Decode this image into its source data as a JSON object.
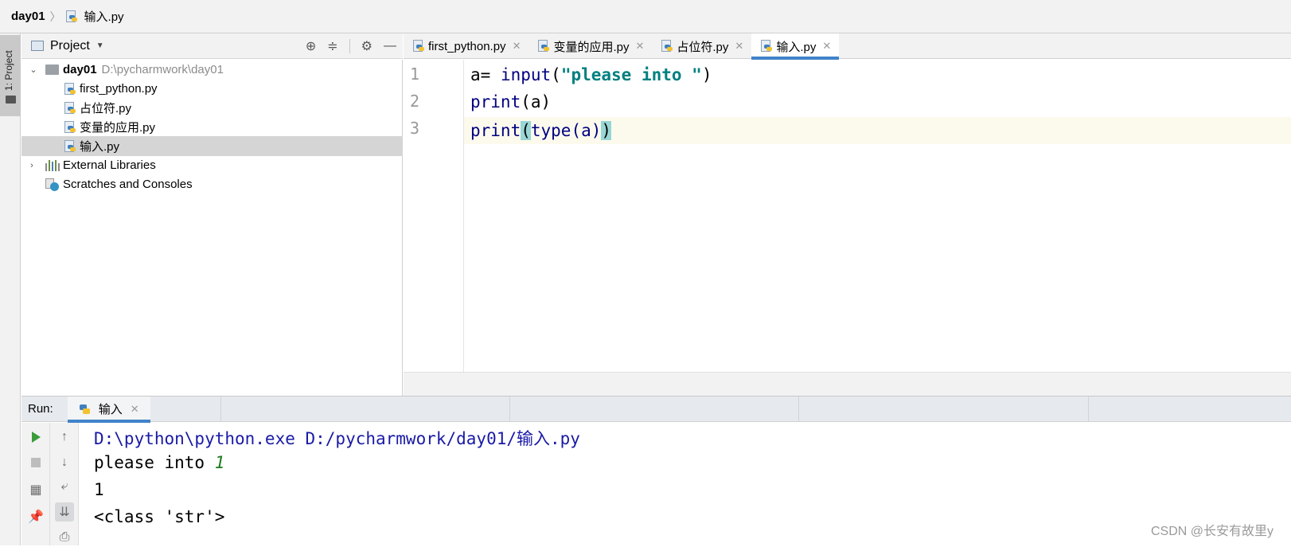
{
  "breadcrumb": {
    "root": "day01",
    "file": "输入.py"
  },
  "tool_stripe": {
    "label": "1: Project"
  },
  "project_panel": {
    "title": "Project",
    "tree": {
      "root_name": "day01",
      "root_path": "D:\\pycharmwork\\day01",
      "files": [
        "first_python.py",
        "占位符.py",
        "变量的应用.py",
        "输入.py"
      ],
      "selected_file": "输入.py",
      "external_libraries": "External Libraries",
      "scratches": "Scratches and Consoles"
    }
  },
  "editor": {
    "tabs": [
      {
        "label": "first_python.py"
      },
      {
        "label": "变量的应用.py"
      },
      {
        "label": "占位符.py"
      },
      {
        "label": "输入.py"
      }
    ],
    "active_tab": "输入.py",
    "line_numbers": [
      "1",
      "2",
      "3"
    ],
    "code": {
      "line1_var": "a= ",
      "line1_func": "input",
      "line1_open": "(",
      "line1_str": "\"please into \"",
      "line1_close": ")",
      "line2_func": "print",
      "line2_rest": "(a)",
      "line3_func": "print",
      "line3_open": "(",
      "line3_inner": "type(a)",
      "line3_close": ")"
    }
  },
  "run_panel": {
    "label": "Run:",
    "tab_label": "输入",
    "console": {
      "command": "D:\\python\\python.exe D:/pycharmwork/day01/输入.py",
      "prompt": "please into ",
      "user_input": "1",
      "output1": "1",
      "output2": "<class 'str'>"
    }
  },
  "watermark": "CSDN @长安有故里y",
  "colors": {
    "accent": "#4083c9",
    "keyword": "#000080",
    "string": "#008080",
    "run_green": "#3a9b3a"
  }
}
